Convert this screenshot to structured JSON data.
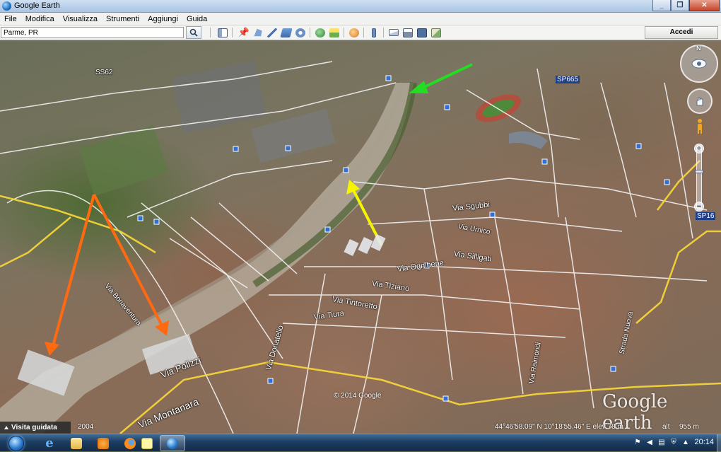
{
  "window": {
    "title": "Google Earth",
    "controls": [
      "min-icon",
      "max-icon",
      "close-icon"
    ]
  },
  "menu": [
    "File",
    "Modifica",
    "Visualizza",
    "Strumenti",
    "Aggiungi",
    "Guida"
  ],
  "search": {
    "value": "Parme, PR",
    "placeholder": ""
  },
  "toolbar": {
    "tools": [
      "sidebar-toggle-icon",
      "placemark-icon",
      "polygon-icon",
      "path-icon",
      "image-overlay-icon",
      "tour-record-icon",
      "historical-imagery-icon",
      "sunlight-icon",
      "planets-icon",
      "ruler-icon",
      "email-icon",
      "print-icon",
      "save-image-icon",
      "google-maps-icon"
    ],
    "signin_label": "Accedi"
  },
  "map": {
    "road_labels": [
      "Via Montanara",
      "Via Polizzi",
      "Via Ognibene",
      "Via Tiziano",
      "Via Tintoretto",
      "Via Tiura",
      "Via Donatello",
      "Via Sgubbi",
      "Via Silligati",
      "Via Bonaventura",
      "Via Urnico",
      "Via Raimondi",
      "Strada Nuova",
      "SP16",
      "SS62",
      "SP665"
    ],
    "copyright": "© 2014 Google",
    "watermark": "Google earth",
    "compass_north": "N",
    "zoom_plus": "+",
    "zoom_minus": "−",
    "zoom_level": 0.35,
    "arrows": [
      {
        "color": "#22dd22",
        "label": "green-arrow"
      },
      {
        "color": "#f5f500",
        "label": "yellow-arrow"
      },
      {
        "color": "#ff6a10",
        "label": "orange-arrow-left"
      },
      {
        "color": "#ff6a10",
        "label": "orange-arrow-right"
      }
    ]
  },
  "status": {
    "tour_label": "Visita guidata",
    "imagery_year": "2004",
    "coords": "44°46'58.09\" N   10°18'55.46\" E   elev   78 m",
    "eye_alt_label": "alt",
    "eye_alt": "955 m"
  },
  "taskbar": {
    "apps": [
      "ie-icon",
      "explorer-icon",
      "media-player-icon",
      "firefox-icon",
      "sticky-note-icon",
      "google-earth-icon"
    ],
    "tray_icons": [
      "flag-icon",
      "volume-icon",
      "network-icon",
      "shield-icon",
      "arrow-icon"
    ],
    "clock": "20:14"
  }
}
